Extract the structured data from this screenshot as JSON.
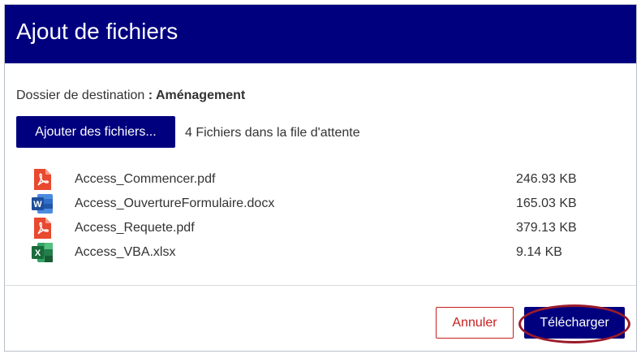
{
  "dialog": {
    "title": "Ajout de fichiers",
    "destination_label": "Dossier de destination",
    "destination_separator": " : ",
    "destination_folder": "Aménagement",
    "add_button_label": "Ajouter des fichiers...",
    "queue_status": "4 Fichiers dans la file d'attente"
  },
  "files": [
    {
      "name": "Access_Commencer.pdf",
      "size": "246.93 KB",
      "icon": "pdf-file-icon"
    },
    {
      "name": "Access_OuvertureFormulaire.docx",
      "size": "165.03 KB",
      "icon": "word-file-icon"
    },
    {
      "name": "Access_Requete.pdf",
      "size": "379.13 KB",
      "icon": "pdf-file-icon"
    },
    {
      "name": "Access_VBA.xlsx",
      "size": "9.14 KB",
      "icon": "excel-file-icon"
    }
  ],
  "footer": {
    "cancel_label": "Annuler",
    "upload_label": "Télécharger"
  },
  "colors": {
    "header_bg": "#00007f",
    "primary_button": "#00007f",
    "cancel_border": "#c81e1e",
    "highlight_ring": "#9b1b2a",
    "pdf": "#e8492f",
    "word": "#2b5fb4",
    "excel": "#1d7a45"
  }
}
